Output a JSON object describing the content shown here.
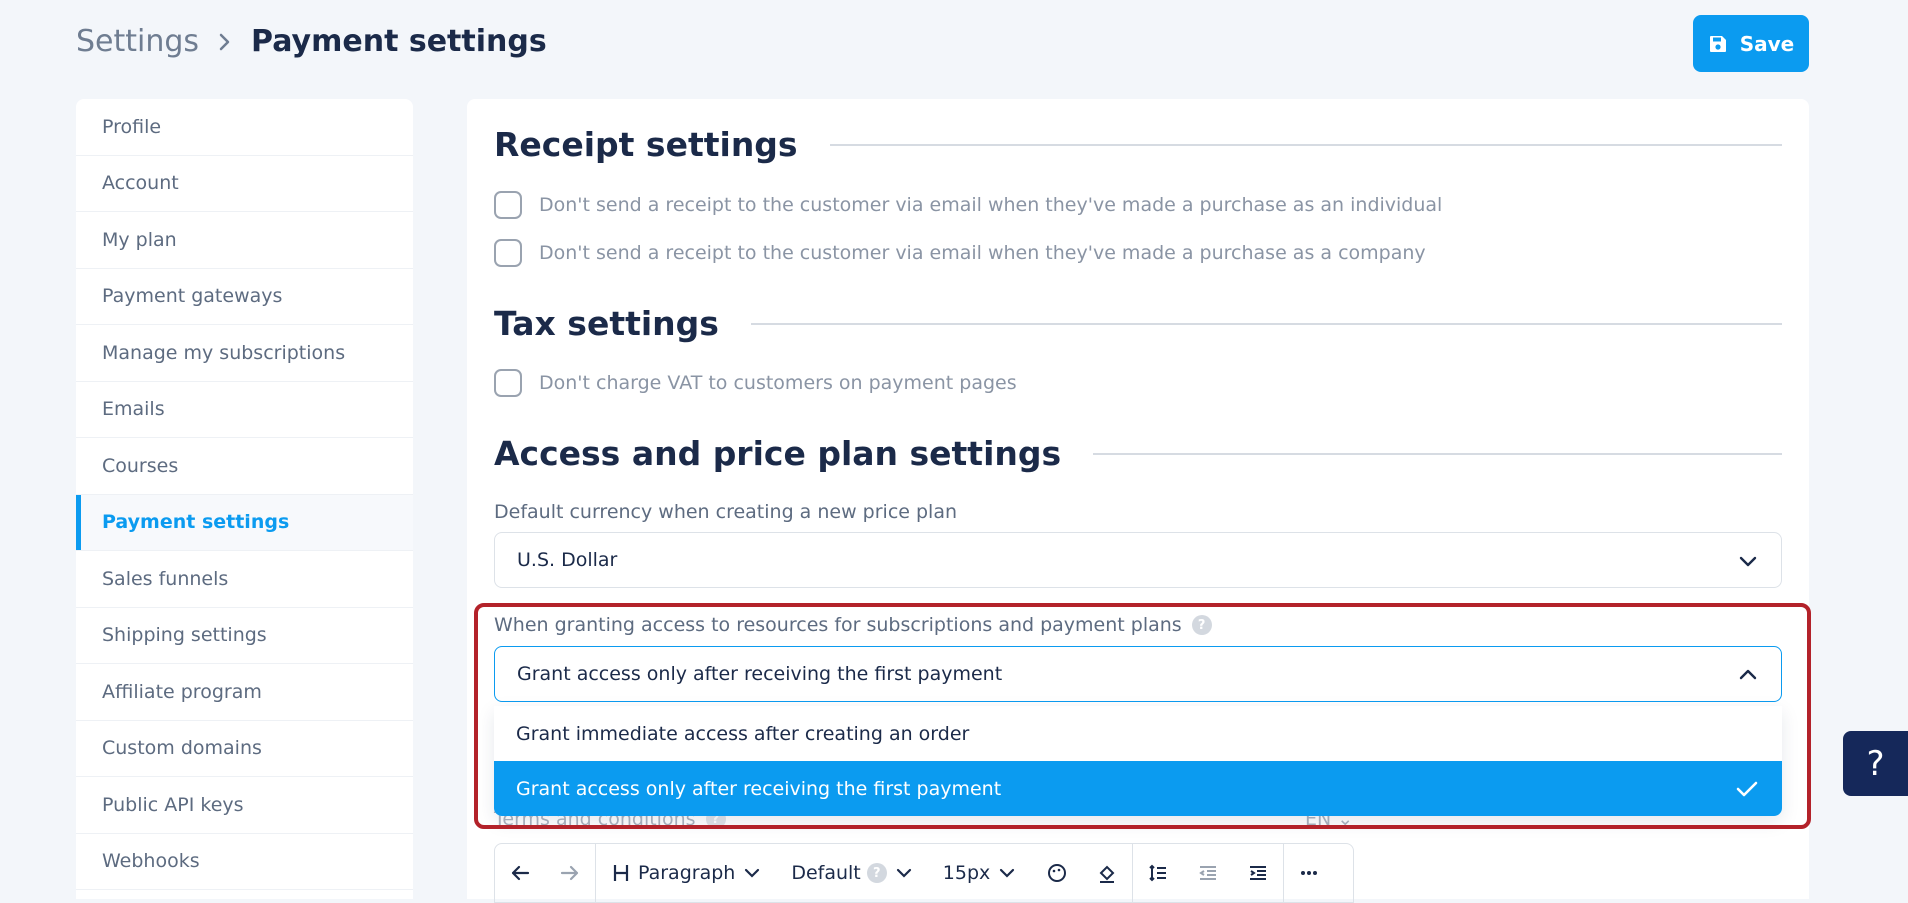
{
  "breadcrumb": {
    "root": "Settings",
    "current": "Payment settings"
  },
  "actions": {
    "save_label": "Save"
  },
  "sidebar": {
    "items": [
      {
        "label": "Profile"
      },
      {
        "label": "Account"
      },
      {
        "label": "My plan"
      },
      {
        "label": "Payment gateways"
      },
      {
        "label": "Manage my subscriptions"
      },
      {
        "label": "Emails"
      },
      {
        "label": "Courses"
      },
      {
        "label": "Payment settings",
        "active": true
      },
      {
        "label": "Sales funnels"
      },
      {
        "label": "Shipping settings"
      },
      {
        "label": "Affiliate program"
      },
      {
        "label": "Custom domains"
      },
      {
        "label": "Public API keys"
      },
      {
        "label": "Webhooks"
      }
    ]
  },
  "receipt": {
    "title": "Receipt settings",
    "options": [
      "Don't send a receipt to the customer via email when they've made a purchase as an individual",
      "Don't send a receipt to the customer via email when they've made a purchase as a company"
    ]
  },
  "tax": {
    "title": "Tax settings",
    "option": "Don't charge VAT to customers on payment pages"
  },
  "access": {
    "title": "Access and price plan settings",
    "currency_label": "Default currency when creating a new price plan",
    "currency_value": "U.S. Dollar",
    "grant_label": "When granting access to resources for subscriptions and payment plans",
    "grant_value": "Grant access only after receiving the first payment",
    "grant_options": [
      "Grant immediate access after creating an order",
      "Grant access only after receiving the first payment"
    ],
    "terms_label": "Terms and conditions",
    "terms_lang": "EN"
  },
  "toolbar": {
    "block_type": "Paragraph",
    "font": "Default",
    "size": "15px"
  },
  "colors": {
    "accent": "#0b9bf0",
    "highlight_outline": "#b3222a",
    "help_fab": "#15285a"
  },
  "help_fab": {
    "label": "?"
  }
}
